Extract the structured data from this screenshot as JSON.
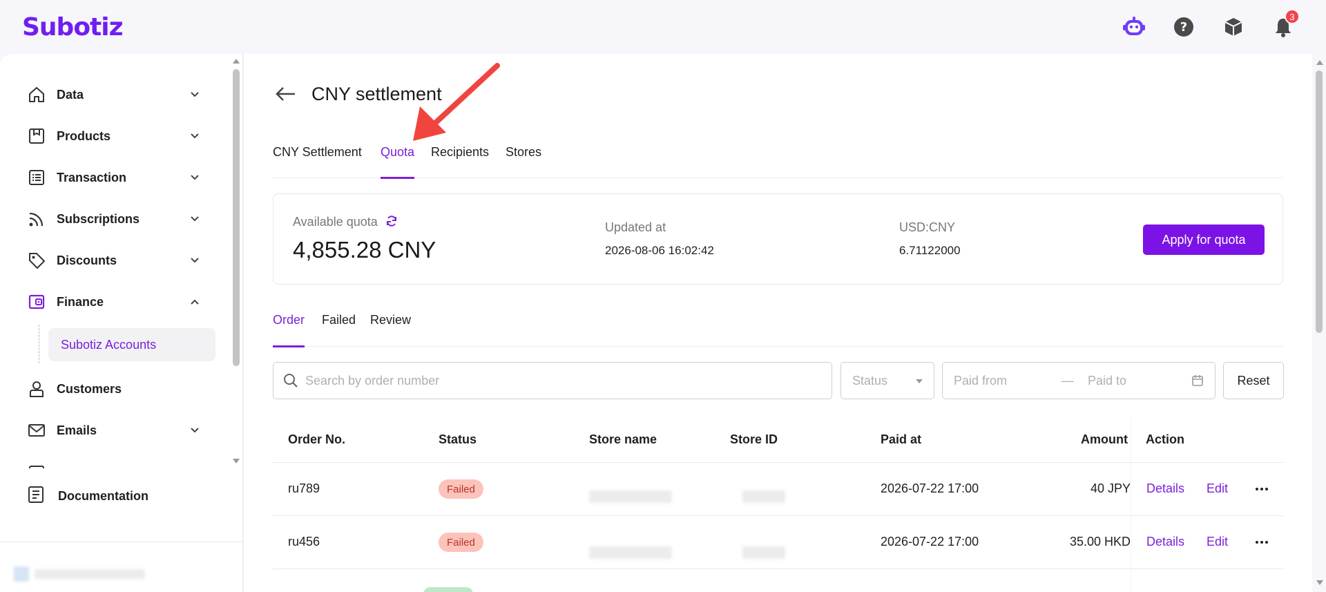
{
  "app": {
    "logo": "Subotiz"
  },
  "header": {
    "notifications_count": "3"
  },
  "sidebar": {
    "items": [
      {
        "label": "Data",
        "icon": "home-icon"
      },
      {
        "label": "Products",
        "icon": "product-icon"
      },
      {
        "label": "Transaction",
        "icon": "list-icon"
      },
      {
        "label": "Subscriptions",
        "icon": "rss-icon"
      },
      {
        "label": "Discounts",
        "icon": "tag-icon"
      },
      {
        "label": "Finance",
        "icon": "wallet-icon"
      },
      {
        "label": "Customers",
        "icon": "user-icon"
      },
      {
        "label": "Emails",
        "icon": "mail-icon"
      }
    ],
    "finance_sub": {
      "label": "Subotiz Accounts"
    },
    "documentation": "Documentation"
  },
  "page": {
    "title": "CNY settlement",
    "tabs": [
      "CNY Settlement",
      "Quota",
      "Recipients",
      "Stores"
    ],
    "active_tab": "Quota"
  },
  "quota": {
    "available_label": "Available quota",
    "available_value": "4,855.28 CNY",
    "updated_label": "Updated at",
    "updated_value": "2026-08-06 16:02:42",
    "rate_label": "USD:CNY",
    "rate_value": "6.71122000",
    "apply_button": "Apply for quota"
  },
  "subtabs": [
    "Order",
    "Failed",
    "Review"
  ],
  "filters": {
    "search_placeholder": "Search by order number",
    "status_placeholder": "Status",
    "paid_from": "Paid from",
    "range_sep": "—",
    "paid_to": "Paid to",
    "reset": "Reset"
  },
  "table": {
    "columns": [
      "Order No.",
      "Status",
      "Store name",
      "Store ID",
      "Paid at",
      "Amount",
      "Action"
    ],
    "rows": [
      {
        "order_no": "ru789",
        "status": "Failed",
        "paid_at": "2026-07-22 17:00",
        "amount": "40 JPY",
        "details": "Details",
        "edit": "Edit"
      },
      {
        "order_no": "ru456",
        "status": "Failed",
        "paid_at": "2026-07-22 17:00",
        "amount": "35.00 HKD",
        "details": "Details",
        "edit": "Edit"
      }
    ]
  },
  "colors": {
    "brand": "#7b20d8",
    "button": "#7b13e6",
    "failed_bg": "#fcc3ba",
    "failed_text": "#b8332b"
  }
}
